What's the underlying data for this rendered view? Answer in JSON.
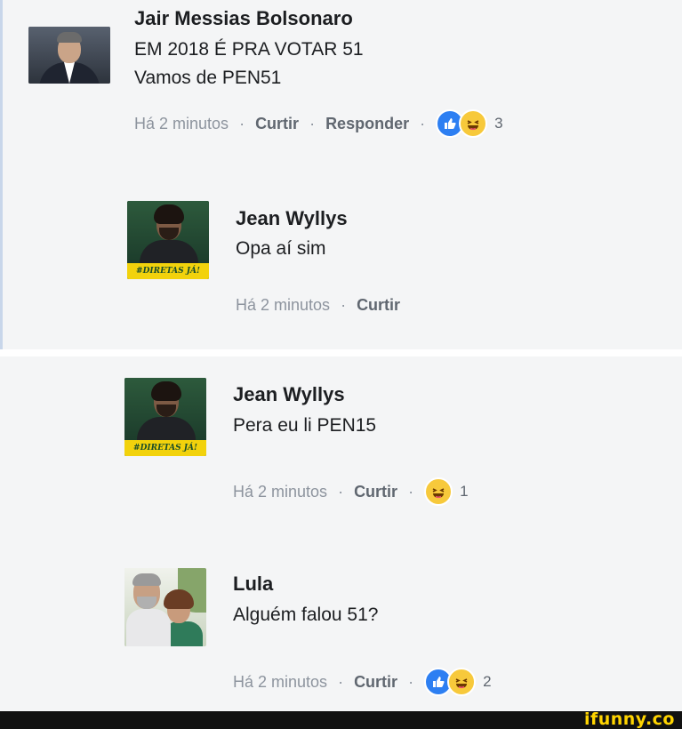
{
  "comments": [
    {
      "author": "Jair Messias Bolsonaro",
      "lines": [
        "EM 2018 É PRA VOTAR 51",
        "Vamos de PEN51"
      ],
      "time": "Há 2 minutos",
      "like": "Curtir",
      "reply": "Responder",
      "reaction_count": "3"
    },
    {
      "author": "Jean Wyllys",
      "lines": [
        "Opa aí sim"
      ],
      "time": "Há 2 minutos",
      "like": "Curtir"
    },
    {
      "author": "Jean Wyllys",
      "lines": [
        "Pera eu li PEN15"
      ],
      "time": "Há 2 minutos",
      "like": "Curtir",
      "reaction_count": "1"
    },
    {
      "author": "Lula",
      "lines": [
        "Alguém falou 51?"
      ],
      "time": "Há 2 minutos",
      "like": "Curtir",
      "reaction_count": "2"
    }
  ],
  "avatar_banner": "#DIRETAS JÁ!",
  "separator": "·",
  "brand": "ifunny.co",
  "colors": {
    "like_blue": "#2d7ff2",
    "haha_yellow": "#f7c93b",
    "brand_yellow": "#ffd400"
  },
  "icons": {
    "like": "thumbs-up-icon",
    "haha": "laughing-face-icon"
  }
}
